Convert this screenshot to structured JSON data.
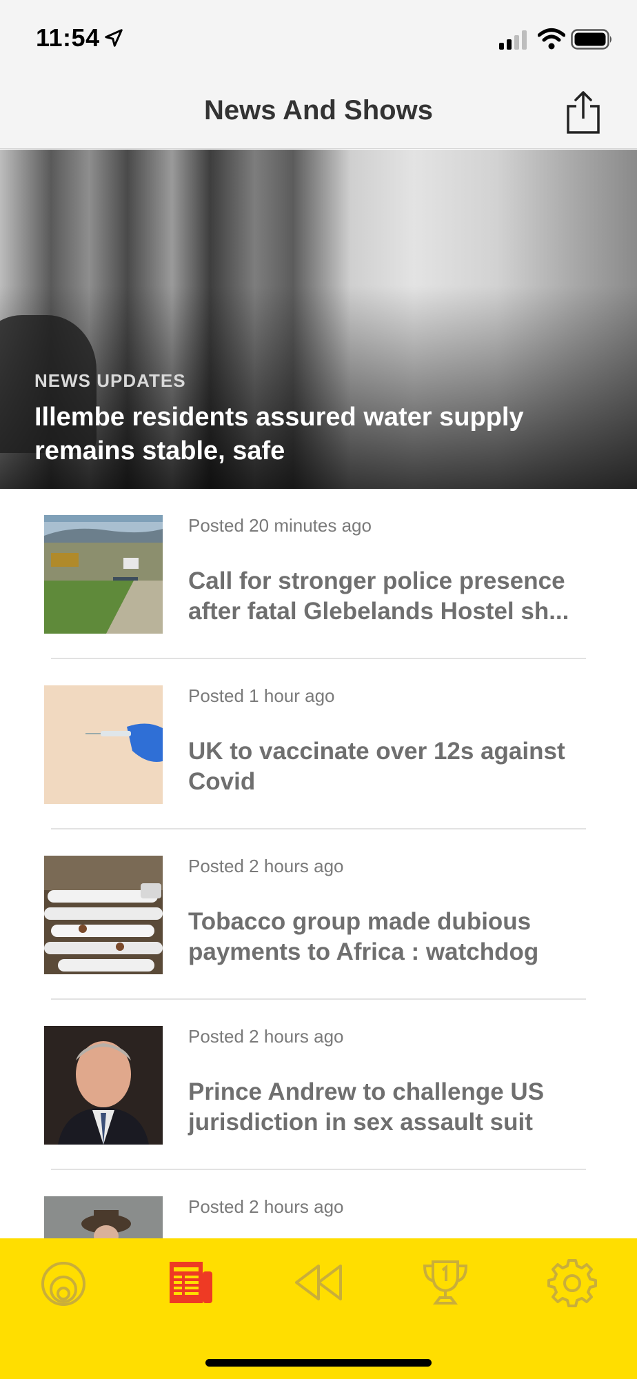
{
  "status": {
    "time": "11:54"
  },
  "header": {
    "title": "News And Shows"
  },
  "hero": {
    "category": "NEWS UPDATES",
    "title": "Illembe residents assured water supply remains stable, safe"
  },
  "articles": [
    {
      "posted": "Posted 20 minutes ago",
      "title": "Call for stronger police presence after fatal Glebelands Hostel sh..."
    },
    {
      "posted": "Posted 1 hour ago",
      "title": "UK to vaccinate over 12s against Covid"
    },
    {
      "posted": "Posted 2 hours ago",
      "title": "Tobacco group made dubious payments to Africa : watchdog"
    },
    {
      "posted": "Posted 2 hours ago",
      "title": "Prince Andrew to challenge US jurisdiction in sex assault suit"
    },
    {
      "posted": "Posted 2 hours ago",
      "title": ""
    }
  ],
  "tabs": [
    {
      "icon": "radio-icon",
      "active": false
    },
    {
      "icon": "newspaper-icon",
      "active": true
    },
    {
      "icon": "rewind-icon",
      "active": false
    },
    {
      "icon": "trophy-icon",
      "active": false
    },
    {
      "icon": "gear-icon",
      "active": false
    }
  ],
  "colors": {
    "tab_bar": "#ffde00",
    "tab_active": "#ee3a24",
    "tab_inactive": "#c9ae3a"
  }
}
